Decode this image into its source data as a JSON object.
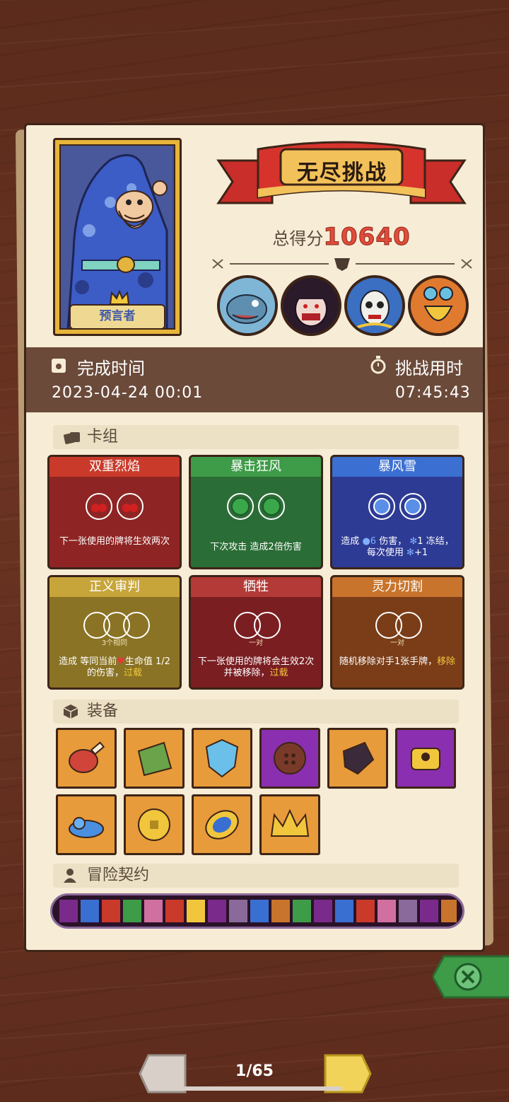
{
  "banner_title": "无尽挑战",
  "score": {
    "label": "总得分",
    "value": "10640"
  },
  "character": {
    "name": "预言者"
  },
  "stats": {
    "completion_time_label": "完成时间",
    "completion_time_value": "2023-04-24 00:01",
    "challenge_duration_label": "挑战用时",
    "challenge_duration_value": "07:45:43"
  },
  "deck": {
    "header": "卡组",
    "cards": [
      {
        "title": "双重烈焰",
        "desc": "下一张使用的牌将生效两次",
        "sub": "",
        "color": "#8e2524",
        "header_color": "#c93a2a"
      },
      {
        "title": "暴击狂风",
        "desc": "下次攻击 造成2倍伤害",
        "sub": "",
        "color": "#2b6d36",
        "header_color": "#3e9b48"
      },
      {
        "title": "暴风雪",
        "desc_a": "造成",
        "desc_b": "6",
        "desc_c": "伤害，",
        "desc_d": "1",
        "desc_e": "冻结，每次使用",
        "desc_f": "+1",
        "sub": "",
        "color": "#2e3b95",
        "header_color": "#3b6fd2"
      },
      {
        "title": "正义审判",
        "desc_a": "造成 等同当前",
        "desc_b": "生命值 1/2 的伤害，",
        "desc_c": "过载",
        "sub": "3个相同",
        "color": "#8a7324",
        "header_color": "#c7a53a"
      },
      {
        "title": "牺牲",
        "desc_a": "下一张使用的牌将会生效2次并被移除，",
        "desc_b": "过载",
        "sub": "一对",
        "color": "#7a1e22",
        "header_color": "#b33a36"
      },
      {
        "title": "灵力切割",
        "desc_a": "随机移除对手1张手牌，",
        "desc_b": "移除",
        "sub": "一对",
        "color": "#7a3d18",
        "header_color": "#c8742c"
      }
    ]
  },
  "equipment": {
    "header": "装备"
  },
  "contracts": {
    "header": "冒险契约"
  },
  "pager": {
    "counter": "1/65"
  }
}
